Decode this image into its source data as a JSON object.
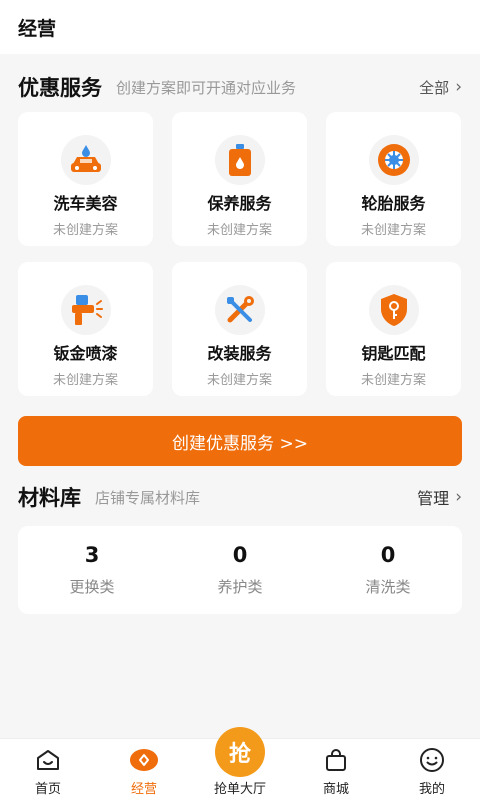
{
  "header": {
    "title": "经营"
  },
  "promo": {
    "title": "优惠服务",
    "subtitle": "创建方案即可开通对应业务",
    "all_label": "全部",
    "services": [
      {
        "name": "洗车美容",
        "status": "未创建方案",
        "icon": "car-wash-icon"
      },
      {
        "name": "保养服务",
        "status": "未创建方案",
        "icon": "oil-can-icon"
      },
      {
        "name": "轮胎服务",
        "status": "未创建方案",
        "icon": "tire-icon"
      },
      {
        "name": "钣金喷漆",
        "status": "未创建方案",
        "icon": "spray-gun-icon"
      },
      {
        "name": "改装服务",
        "status": "未创建方案",
        "icon": "wrench-screwdriver-icon"
      },
      {
        "name": "钥匙匹配",
        "status": "未创建方案",
        "icon": "key-shield-icon"
      }
    ],
    "create_button": "创建优惠服务 >>"
  },
  "materials": {
    "title": "材料库",
    "subtitle": "店铺专属材料库",
    "manage_label": "管理",
    "stats": [
      {
        "value": "3",
        "label": "更换类"
      },
      {
        "value": "0",
        "label": "养护类"
      },
      {
        "value": "0",
        "label": "清洗类"
      }
    ]
  },
  "tabbar": {
    "active": "经营",
    "tabs": [
      {
        "label": "首页",
        "icon": "home-icon"
      },
      {
        "label": "经营",
        "icon": "business-icon"
      },
      {
        "label": "抢单大厅",
        "icon": "grab-order-icon",
        "badge": "抢"
      },
      {
        "label": "商城",
        "icon": "shop-bag-icon"
      },
      {
        "label": "我的",
        "icon": "profile-face-icon"
      }
    ]
  },
  "colors": {
    "accent": "#ef6d0b",
    "grab": "#f49a1a",
    "background": "#f6f6f6"
  }
}
